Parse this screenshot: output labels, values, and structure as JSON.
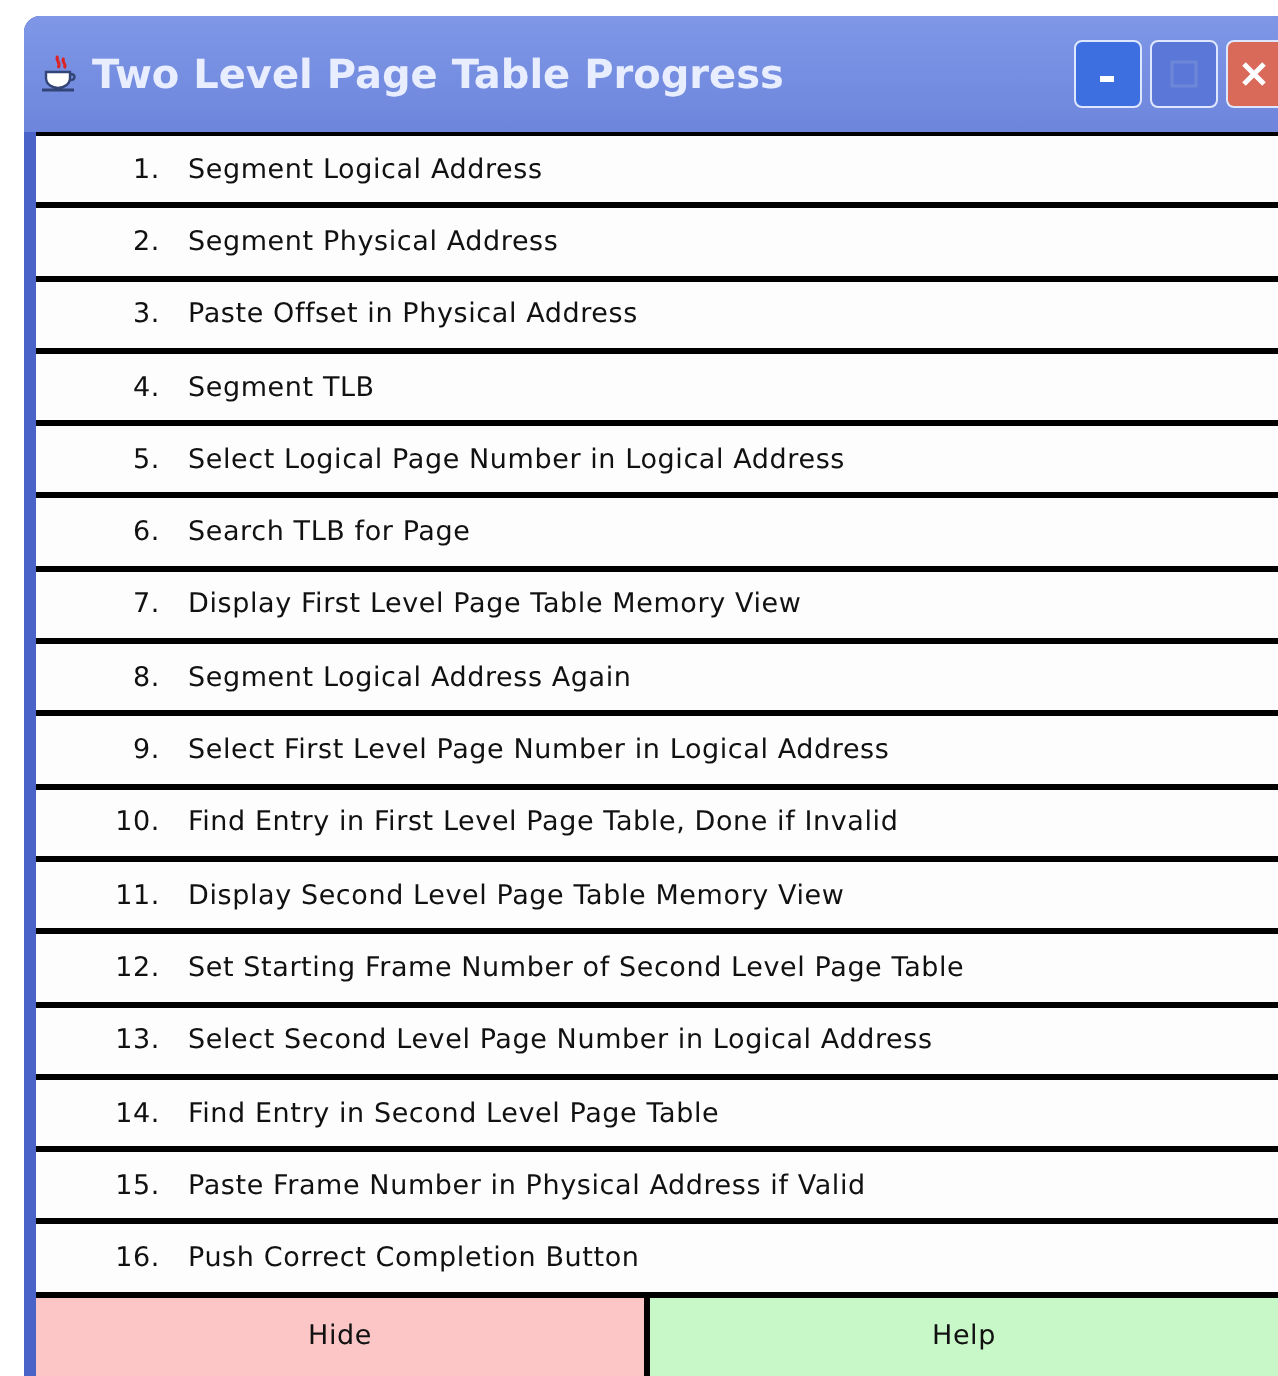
{
  "window": {
    "title": "Two Level Page Table Progress"
  },
  "steps": [
    {
      "number": "1.",
      "label": "Segment Logical Address"
    },
    {
      "number": "2.",
      "label": "Segment Physical Address"
    },
    {
      "number": "3.",
      "label": "Paste Offset in Physical Address"
    },
    {
      "number": "4.",
      "label": "Segment TLB"
    },
    {
      "number": "5.",
      "label": "Select Logical Page Number in Logical Address"
    },
    {
      "number": "6.",
      "label": "Search TLB for Page"
    },
    {
      "number": "7.",
      "label": "Display First Level Page Table Memory View"
    },
    {
      "number": "8.",
      "label": "Segment Logical Address Again"
    },
    {
      "number": "9.",
      "label": "Select First Level Page Number in Logical Address"
    },
    {
      "number": "10.",
      "label": "Find Entry in First Level Page Table, Done if Invalid"
    },
    {
      "number": "11.",
      "label": "Display Second Level Page Table Memory View"
    },
    {
      "number": "12.",
      "label": "Set Starting Frame Number of Second Level Page Table"
    },
    {
      "number": "13.",
      "label": "Select Second Level Page Number in Logical Address"
    },
    {
      "number": "14.",
      "label": "Find Entry in Second Level Page Table"
    },
    {
      "number": "15.",
      "label": "Paste Frame Number in Physical Address if Valid"
    },
    {
      "number": "16.",
      "label": "Push Correct Completion Button"
    }
  ],
  "buttons": [
    {
      "label": "Hide",
      "kind": "hide"
    },
    {
      "label": "Help",
      "kind": "help"
    }
  ]
}
